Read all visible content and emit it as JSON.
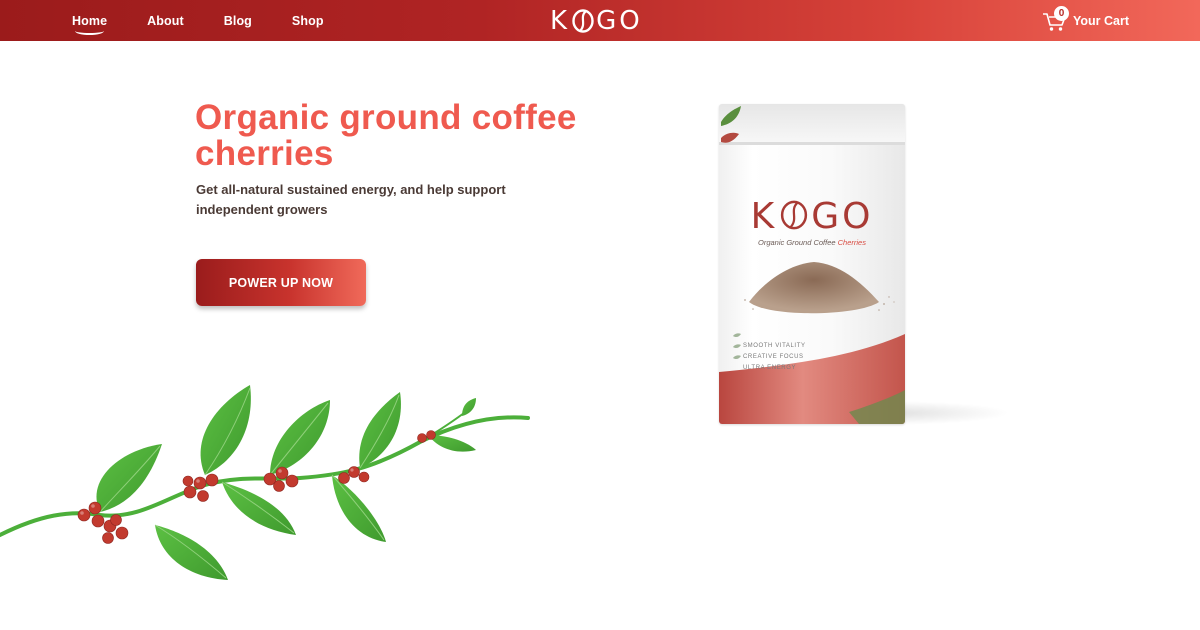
{
  "nav": {
    "items": [
      {
        "label": "Home",
        "active": true
      },
      {
        "label": "About",
        "active": false
      },
      {
        "label": "Blog",
        "active": false
      },
      {
        "label": "Shop",
        "active": false
      }
    ]
  },
  "brand": {
    "left": "K",
    "right": "GO"
  },
  "cart": {
    "count": "0",
    "label": "Your Cart",
    "icon": "shopping-cart-icon"
  },
  "hero": {
    "title": "Organic ground coffee cherries",
    "subtitle": "Get all-natural sustained energy, and help support independent growers",
    "cta_label": "POWER UP NOW"
  },
  "product": {
    "brand_left": "K",
    "brand_right": "GO",
    "tagline_main": "Organic Ground Coffee ",
    "tagline_accent": "Cherries",
    "features": [
      "SMOOTH VITALITY",
      "CREATIVE FOCUS",
      "ULTRA ENERGY"
    ]
  },
  "colors": {
    "header_start": "#9b1b1b",
    "header_end": "#f2685a",
    "title": "#ef5a4f",
    "leaf": "#4caf3a",
    "berry": "#c23a2e"
  }
}
